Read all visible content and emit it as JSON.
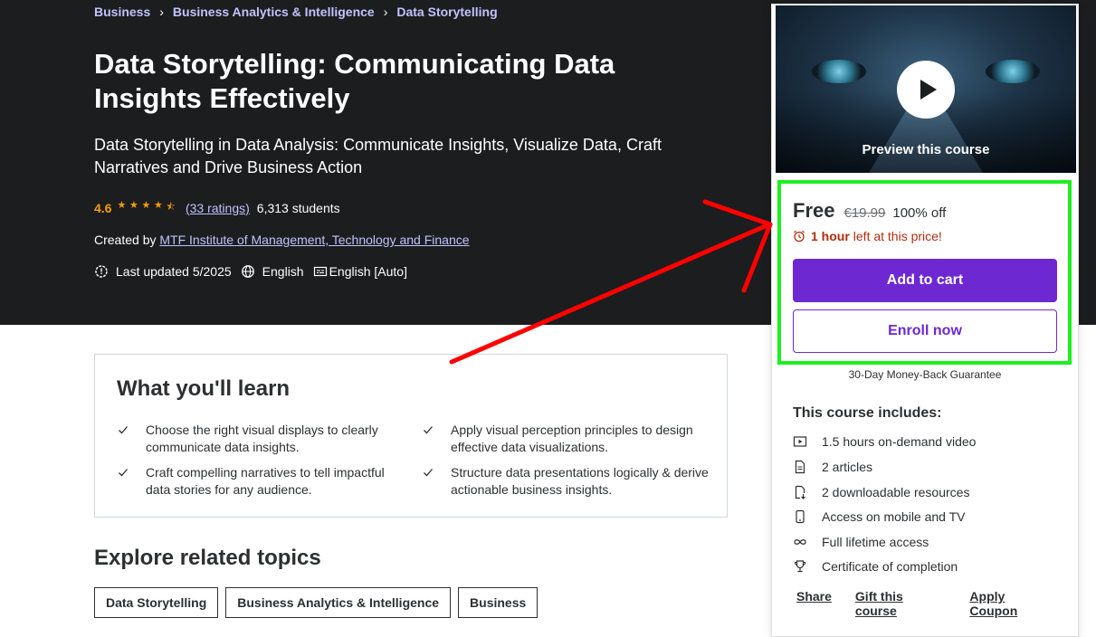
{
  "breadcrumb": [
    "Business",
    "Business Analytics & Intelligence",
    "Data Storytelling"
  ],
  "course": {
    "title": "Data Storytelling: Communicating Data Insights Effectively",
    "subtitle": "Data Storytelling in Data Analysis: Communicate Insights, Visualize Data, Craft Narratives and Drive Business Action",
    "rating": "4.6",
    "stars": 4.5,
    "ratings_count": "(33 ratings)",
    "students": "6,313 students",
    "created_by_label": "Created by",
    "instructor": "MTF Institute of Management, Technology and Finance",
    "last_updated": "Last updated 5/2025",
    "language": "English",
    "captions": "English [Auto]"
  },
  "learn": {
    "title": "What you'll learn",
    "items": [
      "Choose the right visual displays to clearly communicate data insights.",
      "Apply visual perception principles to design effective data visualizations.",
      "Craft compelling narratives to tell impactful data stories for any audience.",
      "Structure data presentations logically & derive actionable business insights."
    ]
  },
  "explore": {
    "title": "Explore related topics",
    "topics": [
      "Data Storytelling",
      "Business Analytics & Intelligence",
      "Business"
    ]
  },
  "sidebar": {
    "preview_label": "Preview this course",
    "price": "Free",
    "original_price": "€19.99",
    "discount": "100% off",
    "timer_bold": "1 hour",
    "timer_text": "left at this price!",
    "add_to_cart": "Add to cart",
    "enroll_now": "Enroll now",
    "guarantee": "30-Day Money-Back Guarantee",
    "includes_title": "This course includes:",
    "includes": [
      {
        "icon": "video-icon",
        "text": "1.5 hours on-demand video"
      },
      {
        "icon": "article-icon",
        "text": "2 articles"
      },
      {
        "icon": "download-icon",
        "text": "2 downloadable resources"
      },
      {
        "icon": "mobile-icon",
        "text": "Access on mobile and TV"
      },
      {
        "icon": "infinity-icon",
        "text": "Full lifetime access"
      },
      {
        "icon": "trophy-icon",
        "text": "Certificate of completion"
      }
    ],
    "links": [
      "Share",
      "Gift this course",
      "Apply Coupon"
    ]
  },
  "colors": {
    "hero_bg": "#1c1d1f",
    "link": "#c0c4fc",
    "star": "#f69c08",
    "primary": "#6d28d2",
    "alert": "#b32d0f",
    "highlight_frame": "#1ef01e",
    "annotation_arrow": "#ff0000"
  }
}
